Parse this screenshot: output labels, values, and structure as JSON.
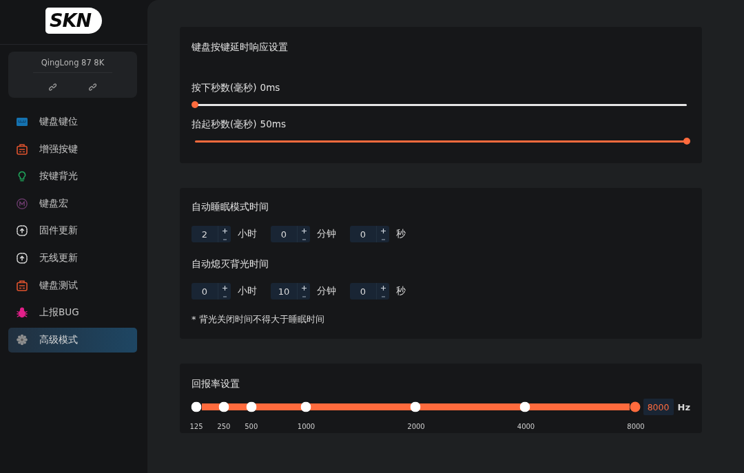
{
  "logo": {
    "text": "SKN"
  },
  "device": {
    "name": "QingLong 87 8K"
  },
  "nav": [
    {
      "label": "键盘键位",
      "selected": false
    },
    {
      "label": "增强按键",
      "selected": false
    },
    {
      "label": "按键背光",
      "selected": false
    },
    {
      "label": "键盘宏",
      "selected": false
    },
    {
      "label": "固件更新",
      "selected": false
    },
    {
      "label": "无线更新",
      "selected": false
    },
    {
      "label": "键盘测试",
      "selected": false
    },
    {
      "label": "上报BUG",
      "selected": false
    },
    {
      "label": "高级模式",
      "selected": true
    }
  ],
  "key_delay": {
    "title": "键盘按键延时响应设置",
    "sliders": [
      {
        "label": "按下秒数(毫秒)",
        "reading": "0ms",
        "level": 0
      },
      {
        "label": "抬起秒数(毫秒)",
        "reading": "50ms",
        "level": 1
      }
    ]
  },
  "timers": {
    "groups": [
      {
        "title": "自动睡眠模式时间",
        "fields": [
          {
            "value": "2",
            "unit": "小时"
          },
          {
            "value": "0",
            "unit": "分钟"
          },
          {
            "value": "0",
            "unit": "秒"
          }
        ]
      },
      {
        "title": "自动熄灭背光时间",
        "fields": [
          {
            "value": "0",
            "unit": "小时"
          },
          {
            "value": "10",
            "unit": "分钟"
          },
          {
            "value": "0",
            "unit": "秒"
          }
        ]
      }
    ],
    "note": "* 背光关闭时间不得大于睡眠时间"
  },
  "polling_rate": {
    "title": "回报率设置",
    "stops": [
      {
        "label": "125",
        "selected": false
      },
      {
        "label": "250",
        "selected": false
      },
      {
        "label": "500",
        "selected": false
      },
      {
        "label": "1000",
        "selected": false
      },
      {
        "label": "2000",
        "selected": false
      },
      {
        "label": "4000",
        "selected": false
      },
      {
        "label": "8000",
        "selected": true
      }
    ],
    "value": "8000",
    "unit": "Hz"
  }
}
